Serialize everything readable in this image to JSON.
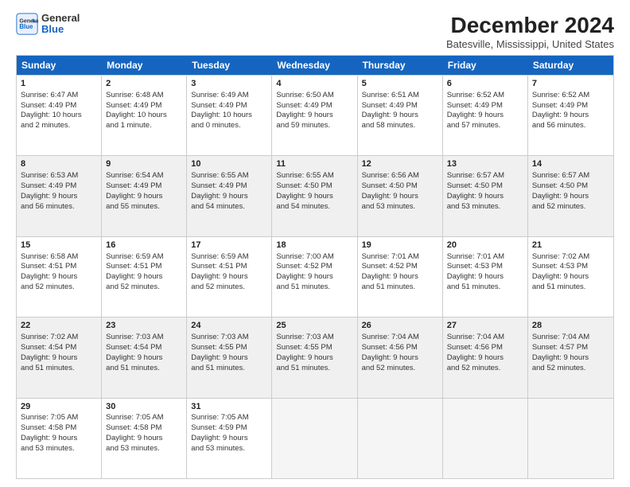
{
  "header": {
    "logo_general": "General",
    "logo_blue": "Blue",
    "title": "December 2024",
    "subtitle": "Batesville, Mississippi, United States"
  },
  "weekdays": [
    "Sunday",
    "Monday",
    "Tuesday",
    "Wednesday",
    "Thursday",
    "Friday",
    "Saturday"
  ],
  "weeks": [
    [
      {
        "day": "1",
        "info": "Sunrise: 6:47 AM\nSunset: 4:49 PM\nDaylight: 10 hours\nand 2 minutes.",
        "empty": false,
        "shaded": false
      },
      {
        "day": "2",
        "info": "Sunrise: 6:48 AM\nSunset: 4:49 PM\nDaylight: 10 hours\nand 1 minute.",
        "empty": false,
        "shaded": false
      },
      {
        "day": "3",
        "info": "Sunrise: 6:49 AM\nSunset: 4:49 PM\nDaylight: 10 hours\nand 0 minutes.",
        "empty": false,
        "shaded": false
      },
      {
        "day": "4",
        "info": "Sunrise: 6:50 AM\nSunset: 4:49 PM\nDaylight: 9 hours\nand 59 minutes.",
        "empty": false,
        "shaded": false
      },
      {
        "day": "5",
        "info": "Sunrise: 6:51 AM\nSunset: 4:49 PM\nDaylight: 9 hours\nand 58 minutes.",
        "empty": false,
        "shaded": false
      },
      {
        "day": "6",
        "info": "Sunrise: 6:52 AM\nSunset: 4:49 PM\nDaylight: 9 hours\nand 57 minutes.",
        "empty": false,
        "shaded": false
      },
      {
        "day": "7",
        "info": "Sunrise: 6:52 AM\nSunset: 4:49 PM\nDaylight: 9 hours\nand 56 minutes.",
        "empty": false,
        "shaded": false
      }
    ],
    [
      {
        "day": "8",
        "info": "Sunrise: 6:53 AM\nSunset: 4:49 PM\nDaylight: 9 hours\nand 56 minutes.",
        "empty": false,
        "shaded": true
      },
      {
        "day": "9",
        "info": "Sunrise: 6:54 AM\nSunset: 4:49 PM\nDaylight: 9 hours\nand 55 minutes.",
        "empty": false,
        "shaded": true
      },
      {
        "day": "10",
        "info": "Sunrise: 6:55 AM\nSunset: 4:49 PM\nDaylight: 9 hours\nand 54 minutes.",
        "empty": false,
        "shaded": true
      },
      {
        "day": "11",
        "info": "Sunrise: 6:55 AM\nSunset: 4:50 PM\nDaylight: 9 hours\nand 54 minutes.",
        "empty": false,
        "shaded": true
      },
      {
        "day": "12",
        "info": "Sunrise: 6:56 AM\nSunset: 4:50 PM\nDaylight: 9 hours\nand 53 minutes.",
        "empty": false,
        "shaded": true
      },
      {
        "day": "13",
        "info": "Sunrise: 6:57 AM\nSunset: 4:50 PM\nDaylight: 9 hours\nand 53 minutes.",
        "empty": false,
        "shaded": true
      },
      {
        "day": "14",
        "info": "Sunrise: 6:57 AM\nSunset: 4:50 PM\nDaylight: 9 hours\nand 52 minutes.",
        "empty": false,
        "shaded": true
      }
    ],
    [
      {
        "day": "15",
        "info": "Sunrise: 6:58 AM\nSunset: 4:51 PM\nDaylight: 9 hours\nand 52 minutes.",
        "empty": false,
        "shaded": false
      },
      {
        "day": "16",
        "info": "Sunrise: 6:59 AM\nSunset: 4:51 PM\nDaylight: 9 hours\nand 52 minutes.",
        "empty": false,
        "shaded": false
      },
      {
        "day": "17",
        "info": "Sunrise: 6:59 AM\nSunset: 4:51 PM\nDaylight: 9 hours\nand 52 minutes.",
        "empty": false,
        "shaded": false
      },
      {
        "day": "18",
        "info": "Sunrise: 7:00 AM\nSunset: 4:52 PM\nDaylight: 9 hours\nand 51 minutes.",
        "empty": false,
        "shaded": false
      },
      {
        "day": "19",
        "info": "Sunrise: 7:01 AM\nSunset: 4:52 PM\nDaylight: 9 hours\nand 51 minutes.",
        "empty": false,
        "shaded": false
      },
      {
        "day": "20",
        "info": "Sunrise: 7:01 AM\nSunset: 4:53 PM\nDaylight: 9 hours\nand 51 minutes.",
        "empty": false,
        "shaded": false
      },
      {
        "day": "21",
        "info": "Sunrise: 7:02 AM\nSunset: 4:53 PM\nDaylight: 9 hours\nand 51 minutes.",
        "empty": false,
        "shaded": false
      }
    ],
    [
      {
        "day": "22",
        "info": "Sunrise: 7:02 AM\nSunset: 4:54 PM\nDaylight: 9 hours\nand 51 minutes.",
        "empty": false,
        "shaded": true
      },
      {
        "day": "23",
        "info": "Sunrise: 7:03 AM\nSunset: 4:54 PM\nDaylight: 9 hours\nand 51 minutes.",
        "empty": false,
        "shaded": true
      },
      {
        "day": "24",
        "info": "Sunrise: 7:03 AM\nSunset: 4:55 PM\nDaylight: 9 hours\nand 51 minutes.",
        "empty": false,
        "shaded": true
      },
      {
        "day": "25",
        "info": "Sunrise: 7:03 AM\nSunset: 4:55 PM\nDaylight: 9 hours\nand 51 minutes.",
        "empty": false,
        "shaded": true
      },
      {
        "day": "26",
        "info": "Sunrise: 7:04 AM\nSunset: 4:56 PM\nDaylight: 9 hours\nand 52 minutes.",
        "empty": false,
        "shaded": true
      },
      {
        "day": "27",
        "info": "Sunrise: 7:04 AM\nSunset: 4:56 PM\nDaylight: 9 hours\nand 52 minutes.",
        "empty": false,
        "shaded": true
      },
      {
        "day": "28",
        "info": "Sunrise: 7:04 AM\nSunset: 4:57 PM\nDaylight: 9 hours\nand 52 minutes.",
        "empty": false,
        "shaded": true
      }
    ],
    [
      {
        "day": "29",
        "info": "Sunrise: 7:05 AM\nSunset: 4:58 PM\nDaylight: 9 hours\nand 53 minutes.",
        "empty": false,
        "shaded": false
      },
      {
        "day": "30",
        "info": "Sunrise: 7:05 AM\nSunset: 4:58 PM\nDaylight: 9 hours\nand 53 minutes.",
        "empty": false,
        "shaded": false
      },
      {
        "day": "31",
        "info": "Sunrise: 7:05 AM\nSunset: 4:59 PM\nDaylight: 9 hours\nand 53 minutes.",
        "empty": false,
        "shaded": false
      },
      {
        "day": "",
        "info": "",
        "empty": true,
        "shaded": false
      },
      {
        "day": "",
        "info": "",
        "empty": true,
        "shaded": false
      },
      {
        "day": "",
        "info": "",
        "empty": true,
        "shaded": false
      },
      {
        "day": "",
        "info": "",
        "empty": true,
        "shaded": false
      }
    ]
  ]
}
